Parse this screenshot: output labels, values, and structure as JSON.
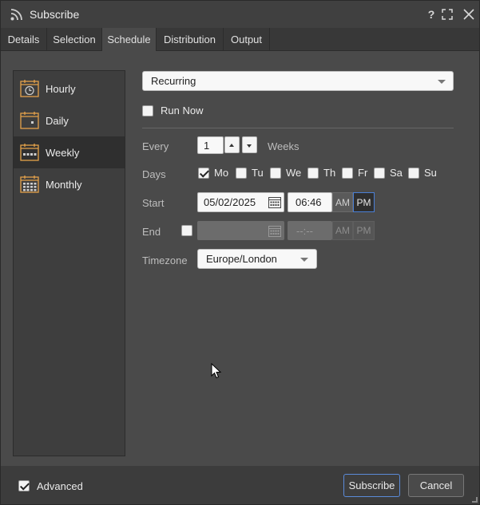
{
  "window": {
    "title": "Subscribe",
    "title_icon": "rss-icon",
    "help_label": "?",
    "colors": {
      "accent": "#5b8bd9",
      "window_bg": "#4a4a4a",
      "titlebar_bg": "#404040",
      "calendar_icon": "#e4a24a"
    }
  },
  "tabs": [
    {
      "label": "Details",
      "active": false
    },
    {
      "label": "Selection",
      "active": false
    },
    {
      "label": "Schedule",
      "active": true
    },
    {
      "label": "Distribution",
      "active": false
    },
    {
      "label": "Output",
      "active": false
    }
  ],
  "schedule_types": [
    {
      "label": "Hourly",
      "icon": "calendar-clock-icon",
      "active": false
    },
    {
      "label": "Daily",
      "icon": "calendar-day-icon",
      "active": false
    },
    {
      "label": "Weekly",
      "icon": "calendar-week-icon",
      "active": true
    },
    {
      "label": "Monthly",
      "icon": "calendar-month-icon",
      "active": false
    }
  ],
  "form": {
    "mode_value": "Recurring",
    "run_now": {
      "label": "Run Now",
      "checked": false
    },
    "every": {
      "label": "Every",
      "value": "1",
      "unit": "Weeks"
    },
    "days": {
      "label": "Days",
      "items": [
        {
          "label": "Mo",
          "checked": true
        },
        {
          "label": "Tu",
          "checked": false
        },
        {
          "label": "We",
          "checked": false
        },
        {
          "label": "Th",
          "checked": false
        },
        {
          "label": "Fr",
          "checked": false
        },
        {
          "label": "Sa",
          "checked": false
        },
        {
          "label": "Su",
          "checked": false
        }
      ]
    },
    "start": {
      "label": "Start",
      "date": "05/02/2025",
      "time": "06:46",
      "am": "AM",
      "pm": "PM",
      "selected": "PM"
    },
    "end": {
      "label": "End",
      "enabled": false,
      "date": "",
      "time": "--:--",
      "am": "AM",
      "pm": "PM"
    },
    "timezone": {
      "label": "Timezone",
      "value": "Europe/London"
    }
  },
  "footer": {
    "advanced": {
      "label": "Advanced",
      "checked": true
    },
    "subscribe_label": "Subscribe",
    "cancel_label": "Cancel"
  }
}
